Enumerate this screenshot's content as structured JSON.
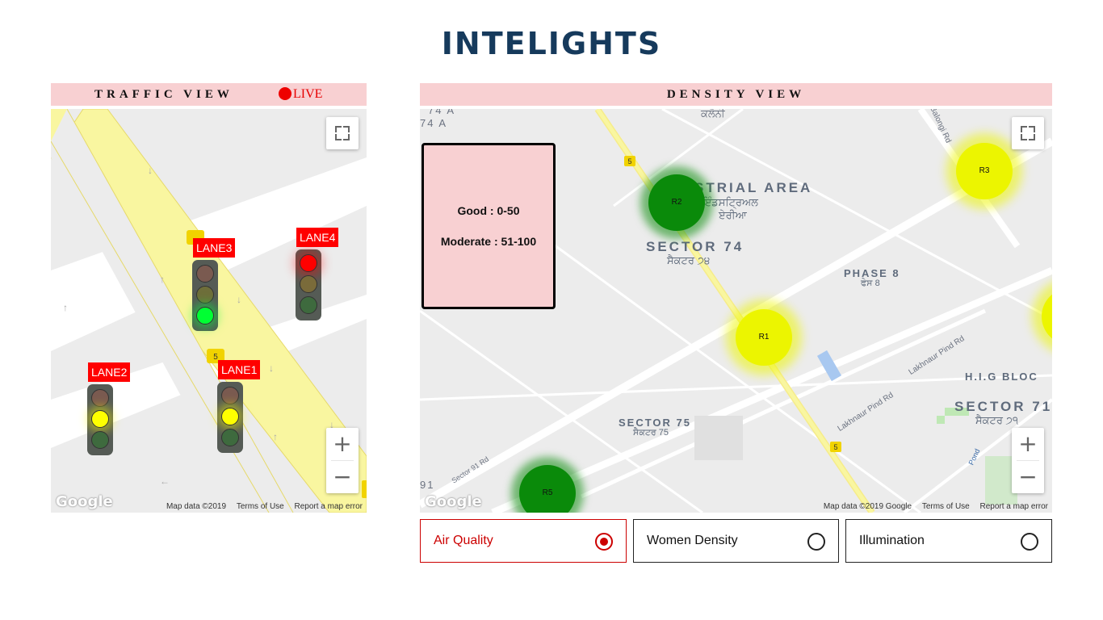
{
  "app": {
    "title": "INTELIGHTS"
  },
  "traffic_view": {
    "header": "TRAFFIC VIEW",
    "live_label": "LIVE",
    "lanes": [
      {
        "label": "LANE1",
        "active_light": "yellow"
      },
      {
        "label": "LANE2",
        "active_light": "yellow"
      },
      {
        "label": "LANE3",
        "active_light": "green"
      },
      {
        "label": "LANE4",
        "active_light": "red"
      }
    ],
    "road_shields": [
      "5",
      "5"
    ],
    "zoom_in": "+",
    "zoom_out": "−",
    "google_logo": "Google",
    "attribution": {
      "map_data": "Map data ©2019",
      "terms": "Terms of Use",
      "report": "Report a map error"
    }
  },
  "density_view": {
    "header": "DENSITY VIEW",
    "legend": {
      "good": "Good : 0-50",
      "moderate": "Moderate : 51-100"
    },
    "regions": [
      {
        "label": "R1",
        "status": "moderate"
      },
      {
        "label": "R2",
        "status": "good"
      },
      {
        "label": "R3",
        "status": "moderate"
      },
      {
        "label": "R5",
        "status": "good"
      }
    ],
    "map_labels": {
      "sector74": "SECTOR 74",
      "sector74_local": "ਸੈਕਟਰ ੭੪",
      "industrial": "STRIAL AREA",
      "industrial_local": "ਇੰਡਸਟ੍ਰਿਅਲ",
      "industrial_local2": "ਏਰੀਆ",
      "phase8": "PHASE 8",
      "phase8_local": "ਫੇਸ 8",
      "sector75": "SECTOR 75",
      "sector75_local": "ਸੈਕਟਰ 75",
      "sector71": "SECTOR 71",
      "sector71_local": "ਸੈਕਟਰ ੭੧",
      "hig": "H.I.G BLOC",
      "lakhnaur1": "Lakhnaur Pind Rd",
      "lakhnaur2": "Lakhnaur Pind Rd",
      "sector91": "91",
      "sector91_rd": "Sector 91 Rd",
      "top74a": "74 A",
      "top74a2": "74 A",
      "kalloni": "ਕਲੋਨੀ",
      "balongi": "Balongi Rd",
      "pond": "Pond",
      "shield": "5"
    },
    "zoom_in": "+",
    "zoom_out": "−",
    "google_logo": "Google",
    "attribution": {
      "map_data": "Map data ©2019 Google",
      "terms": "Terms of Use",
      "report": "Report a map error"
    }
  },
  "options": [
    {
      "label": "Air Quality",
      "selected": true
    },
    {
      "label": "Women Density",
      "selected": false
    },
    {
      "label": "Illumination",
      "selected": false
    }
  ],
  "colors": {
    "good": "#0a8a0a",
    "moderate": "#e8f000",
    "accent": "#cc0000",
    "header_bg": "#f8d0d2"
  }
}
